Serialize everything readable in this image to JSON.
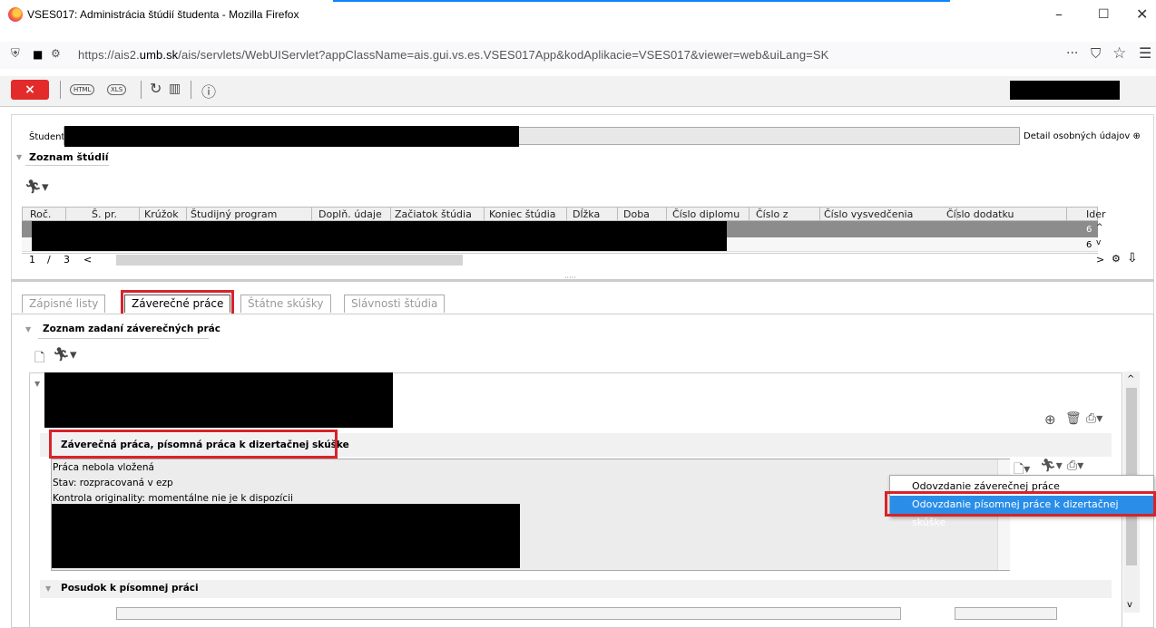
{
  "window": {
    "title": "VSES017: Administrácia štúdií študenta - Mozilla Firefox",
    "minimize": "–",
    "maximize": "☐",
    "close": "✕"
  },
  "browser": {
    "url_prefix": "https://ais2.",
    "url_domain": "umb.sk",
    "url_rest": "/ais/servlets/WebUIServlet?appClassName=ais.gui.vs.es.VSES017App&kodAplikacie=VSES017&viewer=web&uiLang=SK",
    "more": "···",
    "pocket": "⛉",
    "star": "☆",
    "menu": "☰",
    "shield": "⛨",
    "lock": "🔒"
  },
  "apptoolbar": {
    "close_label": "×",
    "html_label": "HTML",
    "xls_label": "XLS",
    "refresh": "↻",
    "info": "ⓘ"
  },
  "student": {
    "label": "Študent",
    "detail_link": "Detail osobných údajov ⊕"
  },
  "studies": {
    "section_title": "Zoznam štúdií",
    "columns": [
      "Roč.",
      "Š. pr.",
      "Krúžok",
      "Študijný program",
      "Doplň. údaje",
      "Začiatok štúdia",
      "Koniec štúdia",
      "Dĺžka",
      "Doba",
      "Číslo diplomu",
      "Číslo z",
      "Číslo vysvedčenia",
      "Číslo dodatku",
      "Ider"
    ],
    "row_end_values": [
      "6",
      "6"
    ],
    "pager_current": "1",
    "pager_sep": "/",
    "pager_total": "3",
    "pager_prev": "<",
    "pager_next": ">",
    "dots": "·····"
  },
  "tabs": [
    {
      "label": "Zápisné listy"
    },
    {
      "label": "Záverečné práce"
    },
    {
      "label": "Štátne skúšky"
    },
    {
      "label": "Slávnosti štúdia"
    }
  ],
  "theses": {
    "section_title": "Zoznam zadaní záverečných prác",
    "subsection_title": "Záverečná práca, písomná práca k dizertačnej skúške",
    "info_lines": [
      "Práca nebola vložená",
      "Stav: rozpracovaná v ezp",
      "Kontrola originality: momentálne nie je k dispozícii"
    ],
    "review_title": "Posudok k písomnej práci"
  },
  "context_menu": {
    "items": [
      {
        "label": "Odovzdanie záverečnej práce"
      },
      {
        "label": "Odovzdanie písomnej práce k dizertačnej skúške"
      }
    ]
  },
  "colors": {
    "accent_red": "#d8232a",
    "menu_highlight": "#2a8ee8",
    "close_btn": "#e32b2b"
  }
}
